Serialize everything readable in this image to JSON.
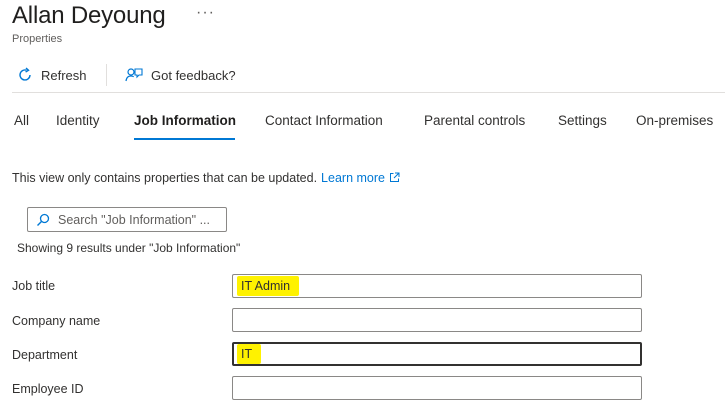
{
  "header": {
    "title": "Allan Deyoung",
    "more_label": "···",
    "subtitle": "Properties"
  },
  "toolbar": {
    "refresh_label": "Refresh",
    "feedback_label": "Got feedback?"
  },
  "tabs": [
    {
      "label": "All",
      "active": false
    },
    {
      "label": "Identity",
      "active": false
    },
    {
      "label": "Job Information",
      "active": true
    },
    {
      "label": "Contact Information",
      "active": false
    },
    {
      "label": "Parental controls",
      "active": false
    },
    {
      "label": "Settings",
      "active": false
    },
    {
      "label": "On-premises",
      "active": false
    }
  ],
  "info": {
    "text": "This view only contains properties that can be updated.",
    "link_label": "Learn more"
  },
  "search": {
    "placeholder": "Search \"Job Information\" ..."
  },
  "results_text": "Showing 9 results under \"Job Information\"",
  "fields": [
    {
      "label": "Job title",
      "value": "IT Admin"
    },
    {
      "label": "Company name",
      "value": ""
    },
    {
      "label": "Department",
      "value": "IT"
    },
    {
      "label": "Employee ID",
      "value": ""
    }
  ],
  "colors": {
    "accent": "#0078d4",
    "highlight": "#fff200"
  }
}
